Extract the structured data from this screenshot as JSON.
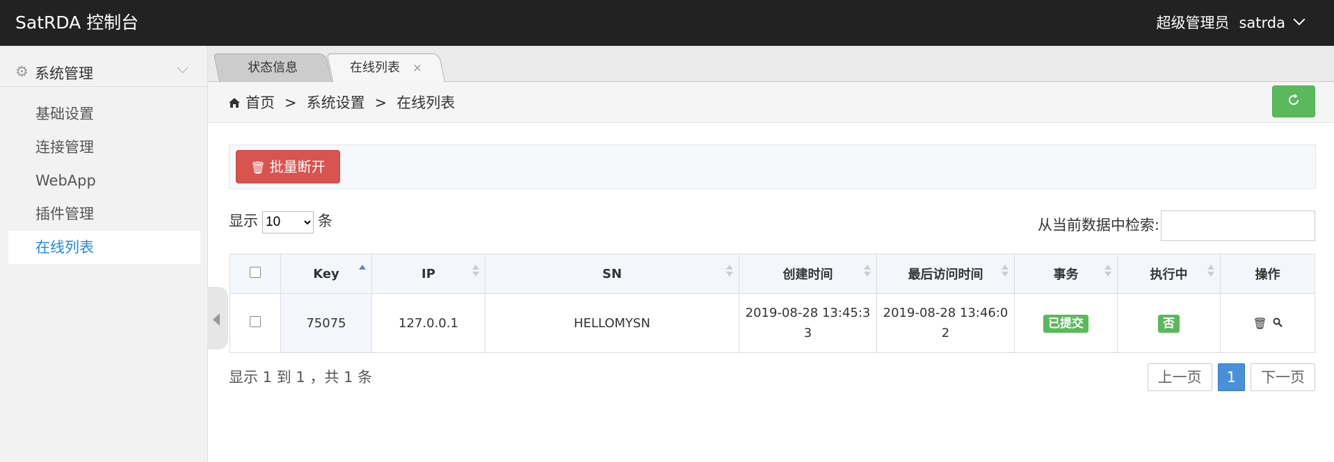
{
  "header": {
    "brand": "SatRDA 控制台",
    "role": "超级管理员",
    "username": "satrda"
  },
  "sidebar": {
    "group_label": "系统管理",
    "items": [
      {
        "label": "基础设置"
      },
      {
        "label": "连接管理"
      },
      {
        "label": "WebApp"
      },
      {
        "label": "插件管理"
      },
      {
        "label": "在线列表"
      }
    ]
  },
  "tabs": [
    {
      "label": "状态信息"
    },
    {
      "label": "在线列表",
      "close": "×"
    }
  ],
  "breadcrumb": {
    "home": "首页",
    "sep": ">",
    "level1": "系统设置",
    "level2": "在线列表"
  },
  "toolbar": {
    "batch_disconnect": "批量断开"
  },
  "length": {
    "prefix": "显示",
    "value": "10",
    "suffix": "条"
  },
  "search": {
    "label": "从当前数据中检索:",
    "value": ""
  },
  "table": {
    "headers": [
      "Key",
      "IP",
      "SN",
      "创建时间",
      "最后访问时间",
      "事务",
      "执行中",
      "操作"
    ],
    "rows": [
      {
        "key": "75075",
        "ip": "127.0.0.1",
        "sn": "HELLOMYSN",
        "created_1": "2019-08-28 13:45:3",
        "created_2": "3",
        "last_1": "2019-08-28 13:46:0",
        "last_2": "2",
        "transaction": "已提交",
        "running": "否"
      }
    ]
  },
  "footer": {
    "info": "显示 1 到 1 ，共 1 条",
    "prev": "上一页",
    "page": "1",
    "next": "下一页"
  },
  "colors": {
    "topbar": "#222222",
    "danger": "#d9534f",
    "success": "#5cb85c",
    "active_link": "#1e88e5",
    "pager_active": "#4a90d9"
  }
}
